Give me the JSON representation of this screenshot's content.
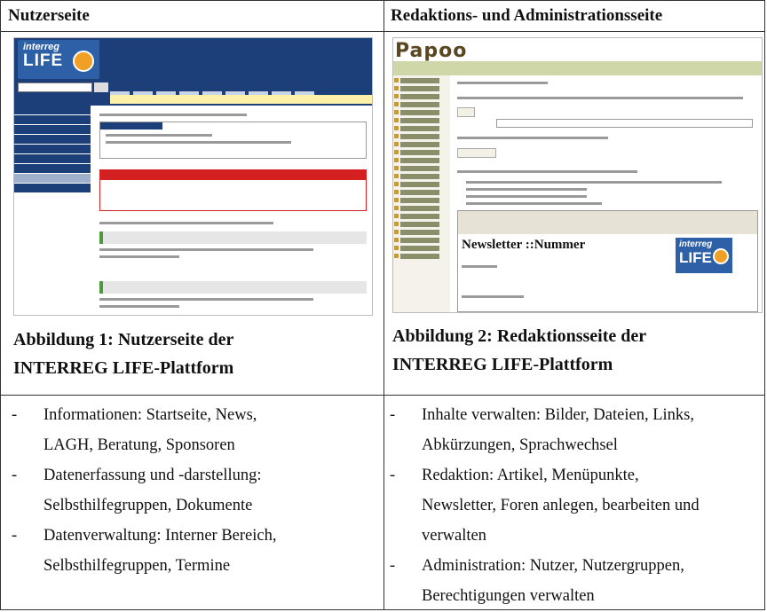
{
  "columns": [
    {
      "heading": "Nutzerseite",
      "caption_line1": "Abbildung 1: Nutzerseite der",
      "caption_line2": "INTERREG LIFE-Plattform",
      "bullets": [
        {
          "line1": "Informationen: Startseite, News,",
          "line2": "LAGH, Beratung, Sponsoren"
        },
        {
          "line1": "Datenerfassung und -darstellung:",
          "line2": "Selbsthilfegruppen, Dokumente"
        },
        {
          "line1": "Datenverwaltung: Interner Bereich,",
          "line2": "Selbsthilfegruppen, Termine"
        }
      ],
      "screenshot": {
        "logo_top": "interreg",
        "logo_main": "LIFE"
      }
    },
    {
      "heading": "Redaktions- und Administrationsseite",
      "caption_line1": "Abbildung 2: Redaktionsseite der",
      "caption_line2": "INTERREG LIFE-Plattform",
      "bullets": [
        {
          "line1": "Inhalte verwalten: Bilder, Dateien, Links,",
          "line2": "Abkürzungen, Sprachwechsel"
        },
        {
          "line1": "Redaktion: Artikel, Menüpunkte,",
          "line2": "Newsletter, Foren anlegen, bearbeiten und",
          "line3": "verwalten"
        },
        {
          "line1": "Administration: Nutzer, Nutzergruppen,",
          "line2": "Berechtigungen verwalten"
        }
      ],
      "screenshot": {
        "brand": "Papoo",
        "newsletter_heading": "Newsletter ::Nummer",
        "logo_top": "interreg",
        "logo_main": "LIFE"
      }
    }
  ]
}
